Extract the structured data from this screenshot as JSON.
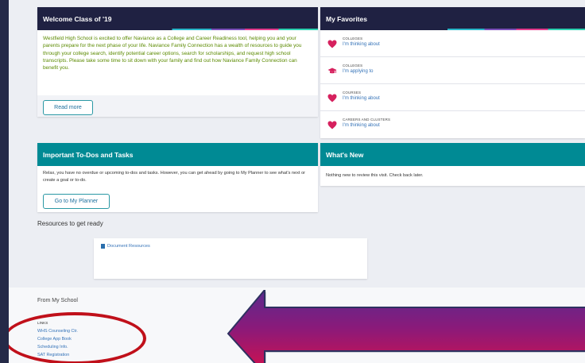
{
  "welcome": {
    "title": "Welcome Class of '19",
    "body": "Westfield High School is excited to offer Naviance as a College and Career Readiness tool, helping you and your parents prepare for the next phase of your life.  Naviance Family Connection has a wealth of resources to guide you through your college search, identify potential career options, search for scholarships, and request high school transcripts.  Please take some time to sit down with your family and find out how Naviance Family Connection can benefit you.",
    "button": "Read more"
  },
  "favorites": {
    "title": "My Favorites",
    "items": [
      {
        "category": "COLLEGES",
        "link": "I'm thinking about",
        "icon": "heart-icon"
      },
      {
        "category": "COLLEGES",
        "link": "I'm applying to",
        "icon": "graduation-cap-icon"
      },
      {
        "category": "COURSES",
        "link": "I'm thinking about",
        "icon": "heart-icon"
      },
      {
        "category": "CAREERS AND CLUSTERS",
        "link": "I'm thinking about",
        "icon": "heart-icon"
      }
    ]
  },
  "todos": {
    "title": "Important To-Dos and Tasks",
    "body": "Relax, you have no overdue or upcoming to-dos and tasks. However, you can get ahead by going to My Planner to see what's next or create a goal or to-do.",
    "button": "Go to My Planner"
  },
  "whats_new": {
    "title": "What's New",
    "body": "Nothing new to review this visit. Check back later."
  },
  "resources": {
    "title": "Resources to get ready",
    "link": "Document Resources"
  },
  "school": {
    "title": "From My School",
    "links_label": "LINKS",
    "links": [
      "WHS Counseling Ctr.",
      "College App Book",
      "Scheduling Info.",
      "SAT Registration"
    ]
  },
  "colors": {
    "header_dark": "#1f2142",
    "header_teal": "#008a94",
    "heart": "#d6215e",
    "link": "#3573b8",
    "annotation_ring": "#c0101a"
  }
}
